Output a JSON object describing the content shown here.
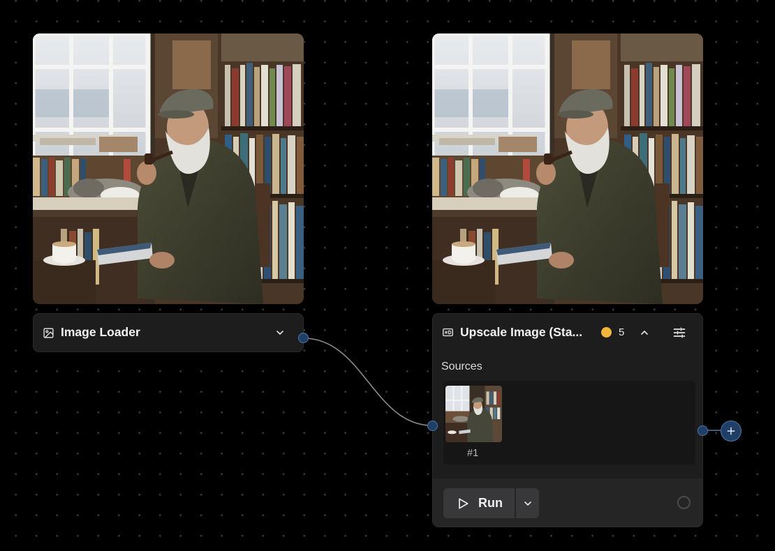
{
  "nodes": {
    "image_loader": {
      "title": "Image Loader",
      "icon": "image-icon",
      "toggle_icon": "chevron-down-icon"
    },
    "upscale_image": {
      "title": "Upscale Image (Sta...",
      "icon": "hd-icon",
      "status_color": "#f4b63a",
      "count": "5",
      "toggle_icon": "chevron-up-icon",
      "settings_icon": "sliders-icon",
      "sources_label": "Sources",
      "sources": [
        {
          "label": "#1"
        }
      ],
      "run_label": "Run",
      "run_icon": "play-icon",
      "run_menu_icon": "chevron-down-icon",
      "progress_icon": "circle-progress-icon"
    }
  },
  "add_output_icon": "plus-icon",
  "colors": {
    "canvas": "#000000",
    "node": "#1d1d1e",
    "port": "#1f3f66",
    "port_border": "#4f78a6",
    "status": "#f4b63a"
  }
}
